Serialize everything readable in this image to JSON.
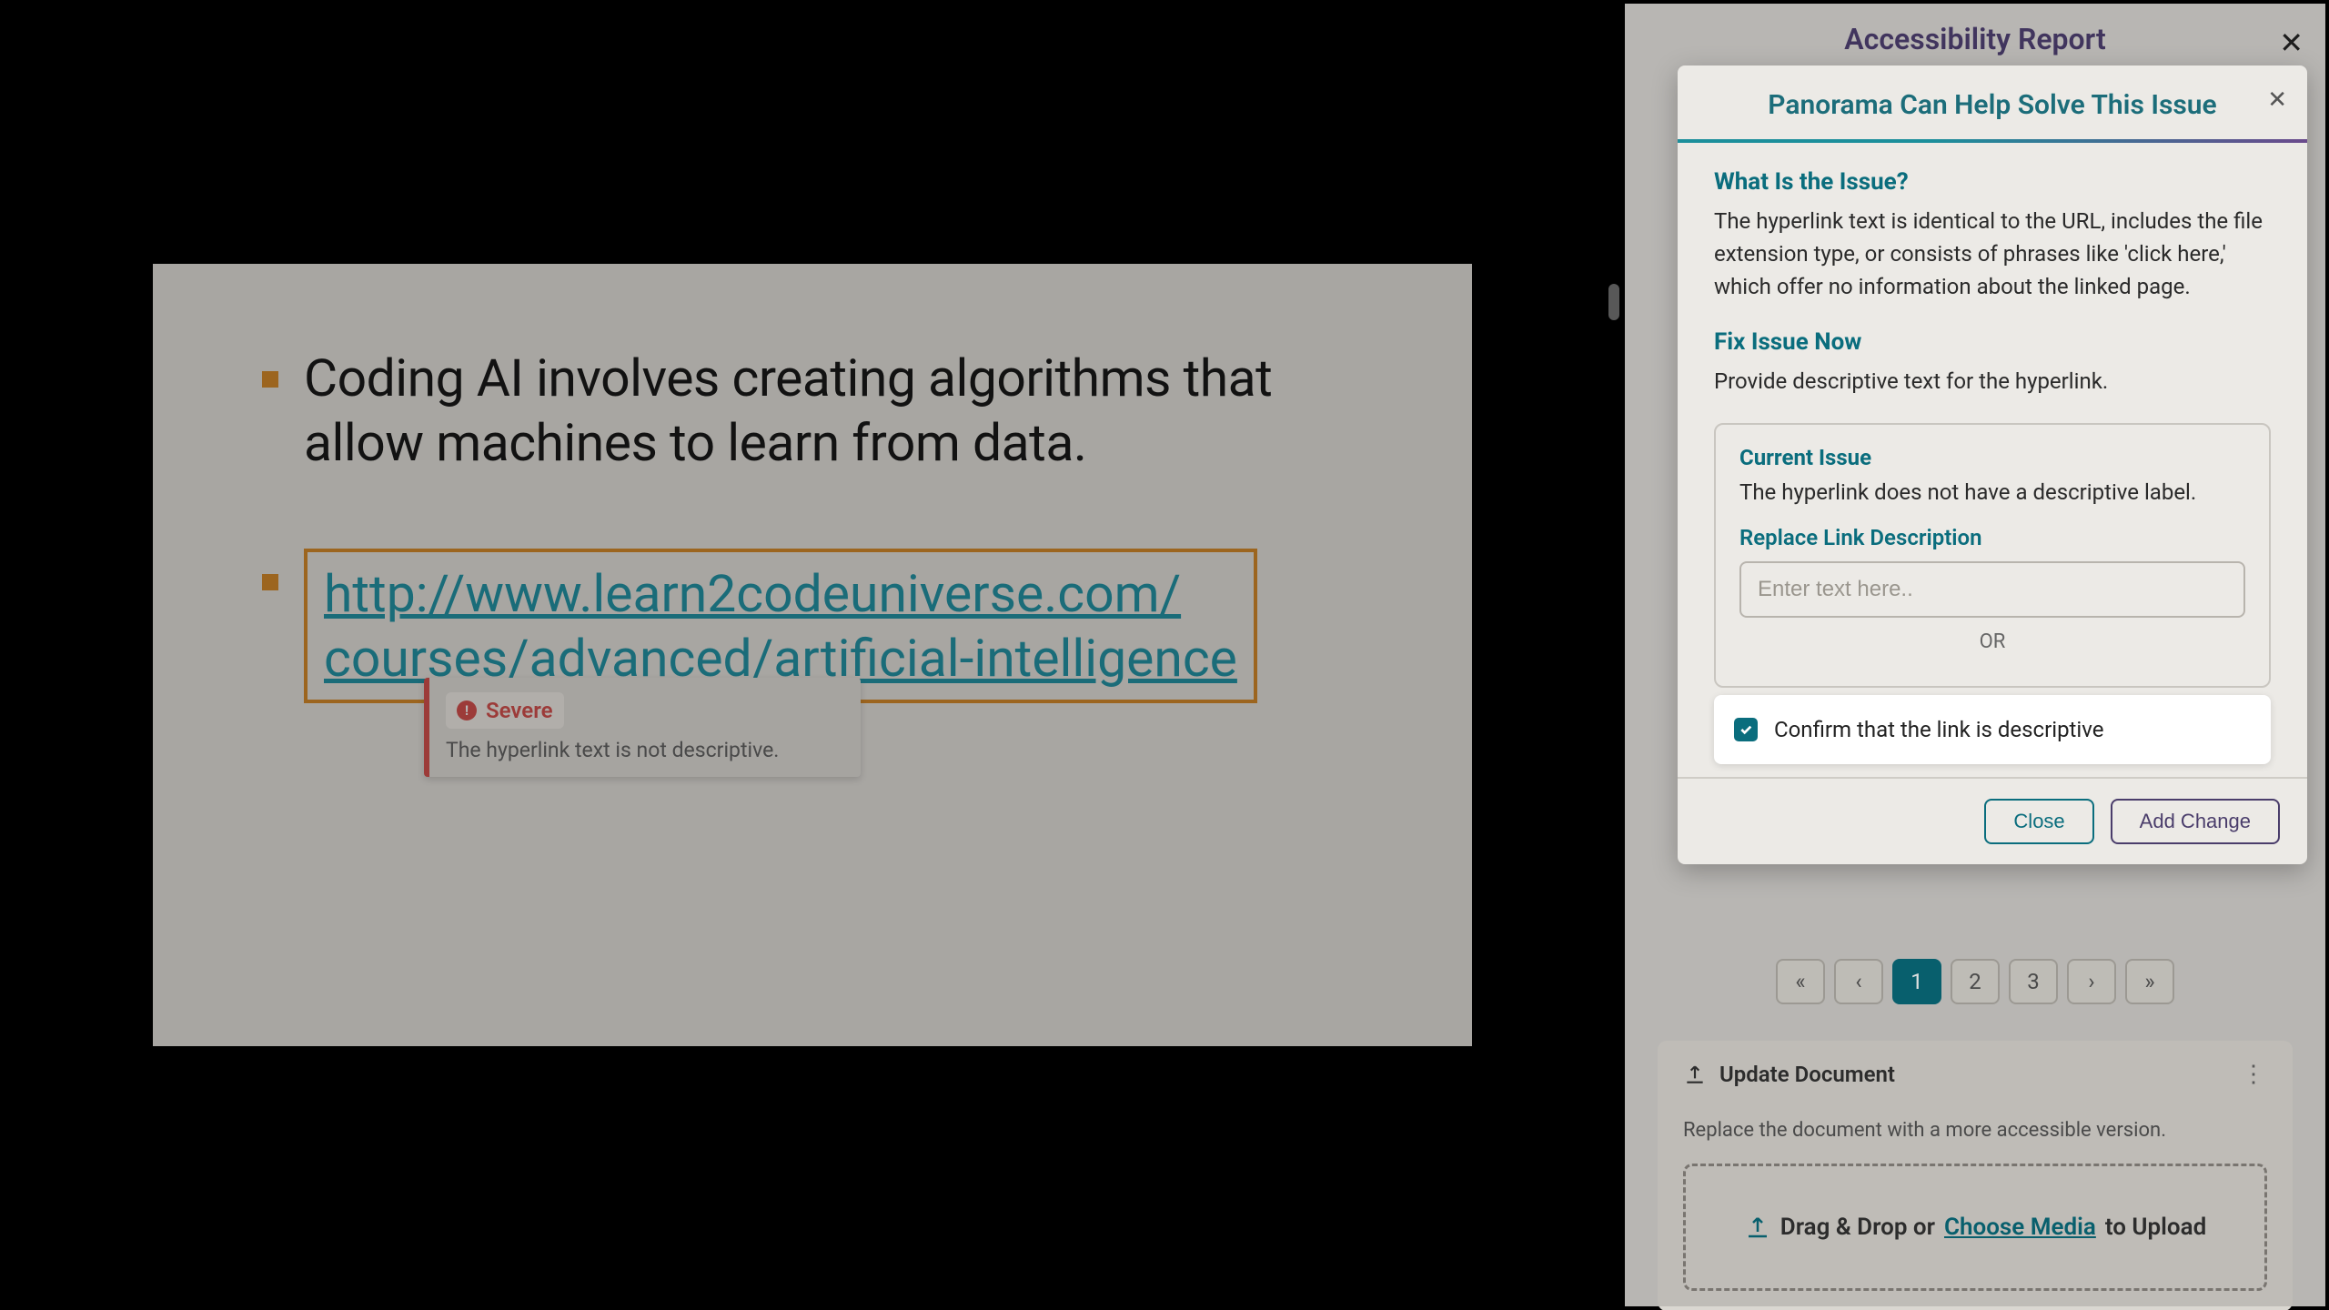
{
  "slide": {
    "bullet1": "Coding AI involves creating algorithms that allow machines to learn from data.",
    "link_line1": "http://www.learn2codeuniverse.com/",
    "link_line2": "courses/advanced/artificial-intelligence"
  },
  "tooltip": {
    "severity": "Severe",
    "text": "The hyperlink text is not descriptive."
  },
  "panel": {
    "title": "Accessibility Report"
  },
  "modal": {
    "title": "Panorama Can Help Solve This Issue",
    "what_heading": "What Is the Issue?",
    "what_body": "The hyperlink text is identical to the URL, includes the file extension type, or consists of phrases like 'click here,' which offer no information about the linked page.",
    "fix_heading": "Fix Issue Now",
    "fix_body": "Provide descriptive text for the hyperlink.",
    "current_issue_heading": "Current Issue",
    "current_issue_body": "The hyperlink does not have a descriptive label.",
    "replace_label": "Replace Link Description",
    "input_placeholder": "Enter text here..",
    "or": "OR",
    "confirm_label": "Confirm that the link is descriptive",
    "close": "Close",
    "add_change": "Add Change"
  },
  "pager": {
    "p1": "1",
    "p2": "2",
    "p3": "3"
  },
  "update": {
    "title": "Update Document",
    "desc": "Replace the document with a more accessible version.",
    "drop1": "Drag & Drop or",
    "choose": "Choose Media",
    "drop2": "to Upload"
  }
}
